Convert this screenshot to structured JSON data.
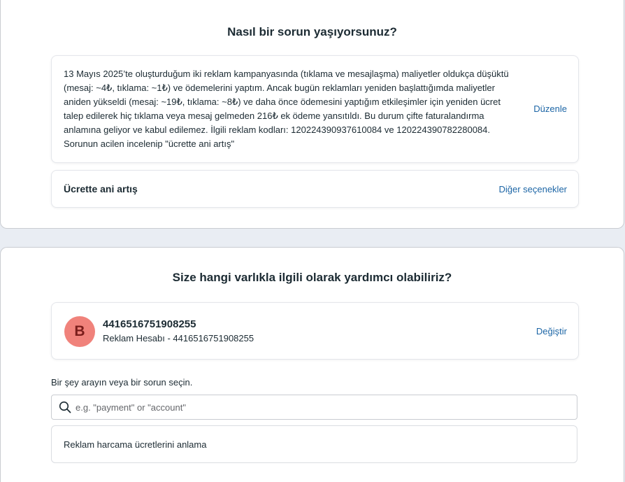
{
  "issue_section": {
    "title": "Nasıl bir sorun yaşıyorsunuz?",
    "description": "13 Mayıs 2025’te oluşturduğum iki reklam kampanyasında (tıklama ve mesajlaşma) maliyetler oldukça düşüktü (mesaj: ~4₺, tıklama: ~1₺) ve ödemelerini yaptım. Ancak bugün reklamları yeniden başlattığımda maliyetler aniden yükseldi (mesaj: ~19₺, tıklama: ~8₺) ve daha önce ödemesini yaptığım etkileşimler için yeniden ücret talep edilerek hiç tıklama veya mesaj gelmeden 216₺ ek ödeme yansıtıldı. Bu durum çifte faturalandırma anlamına geliyor ve kabul edilemez. İlgili reklam kodları: 120224390937610084 ve 120224390782280084. Sorunun acilen incelenip \"ücrette ani artış\"",
    "edit_label": "Düzenle",
    "selected_issue": "Ücrette ani artış",
    "other_options_label": "Diğer seçenekler"
  },
  "asset_section": {
    "title": "Size hangi varlıkla ilgili olarak yardımcı olabiliriz?",
    "avatar_letter": "B",
    "asset_id": "4416516751908255",
    "asset_subtitle": "Reklam Hesabı - 4416516751908255",
    "change_label": "Değiştir"
  },
  "search": {
    "label": "Bir şey arayın veya bir sorun seçin.",
    "placeholder": "e.g. \"payment\" or \"account\"",
    "value": ""
  },
  "options": [
    {
      "label": "Reklam harcama ücretlerini anlama"
    }
  ],
  "colors": {
    "link": "#1d66a6",
    "avatar_bg": "#f0827b",
    "avatar_fg": "#7a1d1b",
    "text": "#1c2b33",
    "background": "#e9edf3"
  },
  "icons": {
    "search": "search-icon"
  }
}
